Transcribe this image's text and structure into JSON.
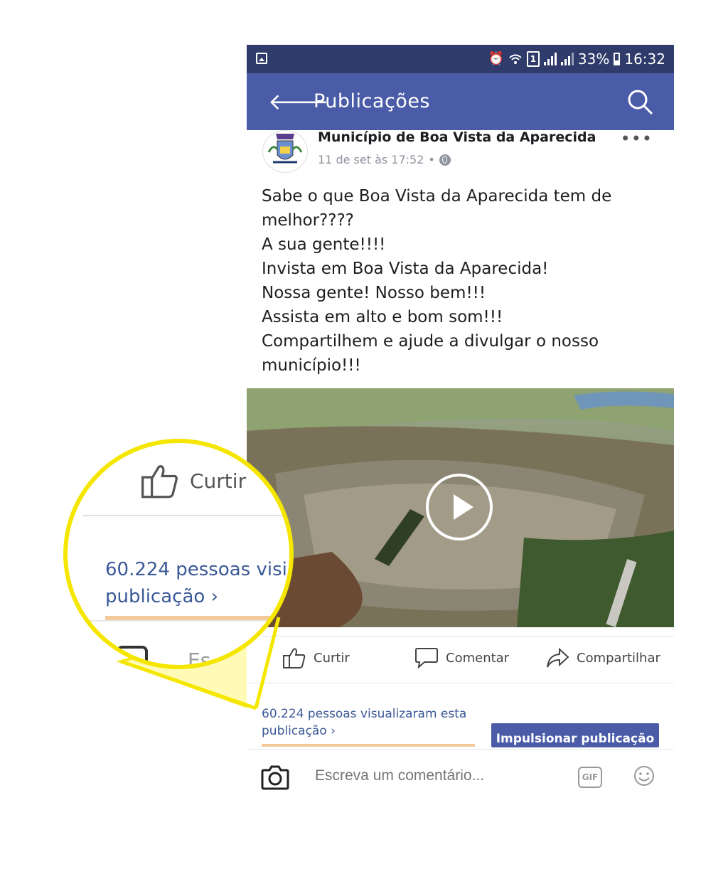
{
  "status_bar": {
    "battery": "33%",
    "time": "16:32",
    "sim": "1",
    "icons": [
      "gallery-icon",
      "alarm-icon",
      "wifi-icon",
      "sim-icon",
      "signal-icon",
      "battery-icon"
    ]
  },
  "app_bar": {
    "title": "Publicações",
    "back_icon": "arrow-left-icon",
    "search_icon": "search-icon",
    "color": "#4a5ca8"
  },
  "post": {
    "page_name": "Município de Boa Vista da Aparecida",
    "timestamp": "11 de set às 17:52",
    "separator": "•",
    "more": "•••",
    "lines": [
      "Sabe o que Boa Vista da Aparecida tem de",
      "melhor????",
      "A sua gente!!!!",
      "Invista em Boa Vista da Aparecida!",
      "Nossa gente!  Nosso bem!!!",
      "Assista em alto e bom som!!!",
      "Compartilhem e ajude a divulgar o nosso",
      "município!!!"
    ]
  },
  "actions": {
    "like": "Curtir",
    "comment": "Comentar",
    "share": "Compartilhar"
  },
  "insights": {
    "views_line1": "60.224 pessoas visualizaram esta",
    "views_line2": "publicação",
    "boost_label": "Impulsionar publicação"
  },
  "comment_bar": {
    "placeholder": "Escreva um comentário...",
    "gif_label": "GIF"
  },
  "magnifier": {
    "like": "Curtir",
    "views_line1": "60.224 pessoas visi",
    "views_line2": "publicação",
    "partial_text": "Es",
    "ring_color": "#f5e600"
  }
}
